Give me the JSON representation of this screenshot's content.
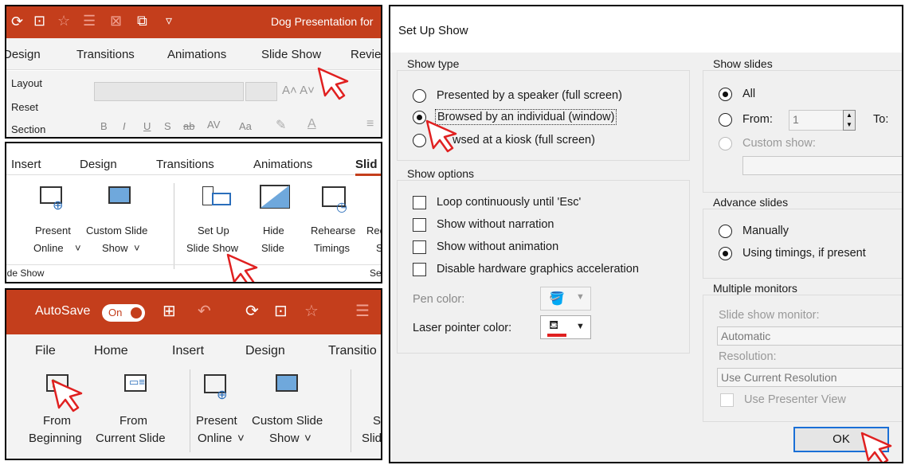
{
  "panel1": {
    "title": "Dog Presentation for",
    "tabs": [
      "Design",
      "Transitions",
      "Animations",
      "Slide Show",
      "Revie"
    ],
    "commands": [
      "Layout",
      "Reset",
      "Section"
    ],
    "font_row": [
      "B",
      "I",
      "U",
      "S",
      "ab",
      "AV",
      "Aa"
    ]
  },
  "panel2": {
    "tabs": [
      "Insert",
      "Design",
      "Transitions",
      "Animations",
      "Slid"
    ],
    "buttons": [
      {
        "line1": "Present",
        "line2": "Online"
      },
      {
        "line1": "Custom Slide",
        "line2": "Show"
      },
      {
        "line1": "Set Up",
        "line2": "Slide Show"
      },
      {
        "line1": "Hide",
        "line2": "Slide"
      },
      {
        "line1": "Rehearse",
        "line2": "Timings"
      },
      {
        "line1": "Rec",
        "line2": "S"
      }
    ],
    "group_left": "ide Show",
    "group_right": "Se"
  },
  "panel3": {
    "autosave": "AutoSave",
    "toggle": "On",
    "tabs": [
      "File",
      "Home",
      "Insert",
      "Design",
      "Transitio"
    ],
    "buttons": [
      {
        "line1": "From",
        "line2": "Beginning"
      },
      {
        "line1": "From",
        "line2": "Current Slide"
      },
      {
        "line1": "Present",
        "line2": "Online"
      },
      {
        "line1": "Custom Slide",
        "line2": "Show"
      },
      {
        "line1": "S",
        "line2": "Slid"
      }
    ]
  },
  "dialog": {
    "title": "Set Up Show",
    "show_type": {
      "label": "Show type",
      "options": [
        "Presented by a speaker (full screen)",
        "Browsed by an individual (window)",
        "wsed at a kiosk (full screen)"
      ],
      "selected": 1
    },
    "show_options": {
      "label": "Show options",
      "checks": [
        "Loop continuously until 'Esc'",
        "Show without narration",
        "Show without animation",
        "Disable hardware graphics acceleration"
      ],
      "pen_color": "Pen color:",
      "laser_color": "Laser pointer color:"
    },
    "show_slides": {
      "label": "Show slides",
      "all": "All",
      "from": "From:",
      "from_value": "1",
      "to": "To:",
      "custom": "Custom show:"
    },
    "advance": {
      "label": "Advance slides",
      "manually": "Manually",
      "timings": "Using timings, if present"
    },
    "monitors": {
      "label": "Multiple monitors",
      "monitor_label": "Slide show monitor:",
      "monitor_value": "Automatic",
      "resolution_label": "Resolution:",
      "resolution_value": "Use Current Resolution",
      "presenter": "Use Presenter View"
    },
    "ok": "OK"
  },
  "colors": {
    "accent": "#c43e1c",
    "laser": "#e02020"
  }
}
